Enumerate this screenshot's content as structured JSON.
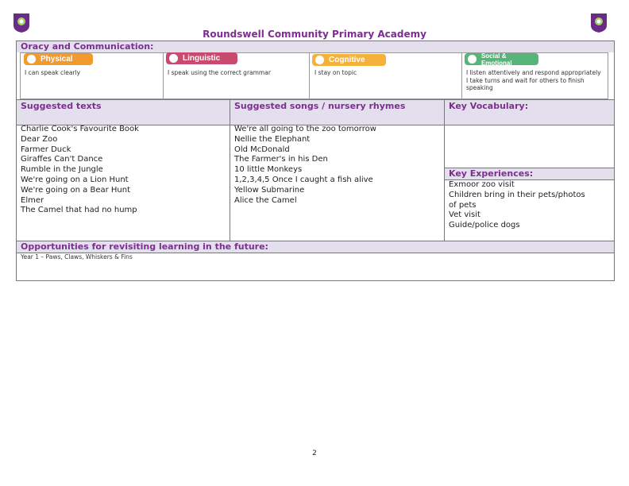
{
  "header": {
    "title": "Roundswell Community Primary Academy"
  },
  "oracy": {
    "heading": "Oracy and Communication:",
    "categories": [
      {
        "label": "Physical",
        "icon": "figure-icon",
        "color": "#f29a2e",
        "statement": "I can speak clearly"
      },
      {
        "label": "Linguistic",
        "icon": "speech-bubble-icon",
        "color": "#c84a6e",
        "statement": "I speak using the correct grammar"
      },
      {
        "label": "Cognitive",
        "icon": "lightbulb-icon",
        "color": "#f4b23c",
        "statement": "I stay on topic"
      },
      {
        "label": "Social & Emotional",
        "icon": "people-icon",
        "color": "#58b57a",
        "statement": "I listen attentively and respond appropriately\nI take turns and wait for others to finish speaking"
      }
    ]
  },
  "sections": {
    "texts_heading": "Suggested texts",
    "songs_heading": "Suggested songs / nursery rhymes",
    "vocab_heading": "Key Vocabulary:",
    "experiences_heading": "Key Experiences:"
  },
  "texts": [
    "Charlie Cook's Favourite Book",
    "Dear Zoo",
    "Farmer Duck",
    "Giraffes Can't Dance",
    "Rumble in the Jungle",
    "We're going on a Lion Hunt",
    "We're going on a Bear Hunt",
    "Elmer",
    "The Camel that had no hump"
  ],
  "songs": [
    "We're all going to the zoo tomorrow",
    "Nellie the Elephant",
    "Old McDonald",
    "The Farmer's in his Den",
    "10 little Monkeys",
    "1,2,3,4,5 Once I caught a fish alive",
    "Yellow Submarine",
    "Alice the Camel"
  ],
  "experiences": [
    "Exmoor zoo visit",
    "Children bring in their pets/photos",
    "of pets",
    "Vet visit",
    "Guide/police dogs"
  ],
  "future": {
    "heading": "Opportunities for revisiting learning in the future:",
    "text": "Year 1 – Paws, Claws, Whiskers & Fins"
  },
  "page_number": "2"
}
